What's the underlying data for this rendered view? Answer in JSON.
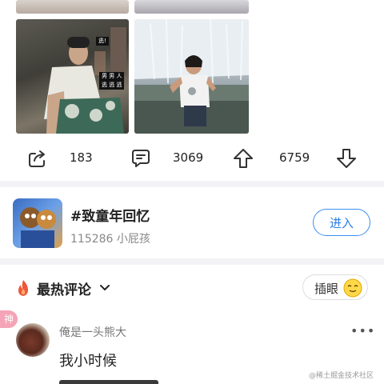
{
  "post": {
    "photo_overlay_tags": [
      "逃!",
      "男 男 人",
      "逃 逃 逃"
    ]
  },
  "toolbar": {
    "share_count": "183",
    "comment_count": "3069",
    "upvote_count": "6759"
  },
  "group": {
    "title": "#致童年回忆",
    "subtitle": "115286 小屁孩",
    "enter_label": "进入"
  },
  "comments": {
    "section_title": "最热评论",
    "insert_label": "插眼",
    "god_badge": "神",
    "items": [
      {
        "username": "俺是一头熊大",
        "text": "我小时候",
        "more": "•••"
      }
    ]
  },
  "watermark": "@稀土掘金技术社区",
  "colors": {
    "accent": "#2a7ee8",
    "flame": "#f0573a",
    "badge": "#f5a3b6"
  },
  "icons": {
    "share": "share-icon",
    "comment": "comment-icon",
    "upvote": "upvote-arrow-icon",
    "downvote": "downvote-arrow-icon",
    "flame": "flame-icon",
    "chevron": "chevron-down-icon",
    "emoji": "emoji-icon"
  }
}
